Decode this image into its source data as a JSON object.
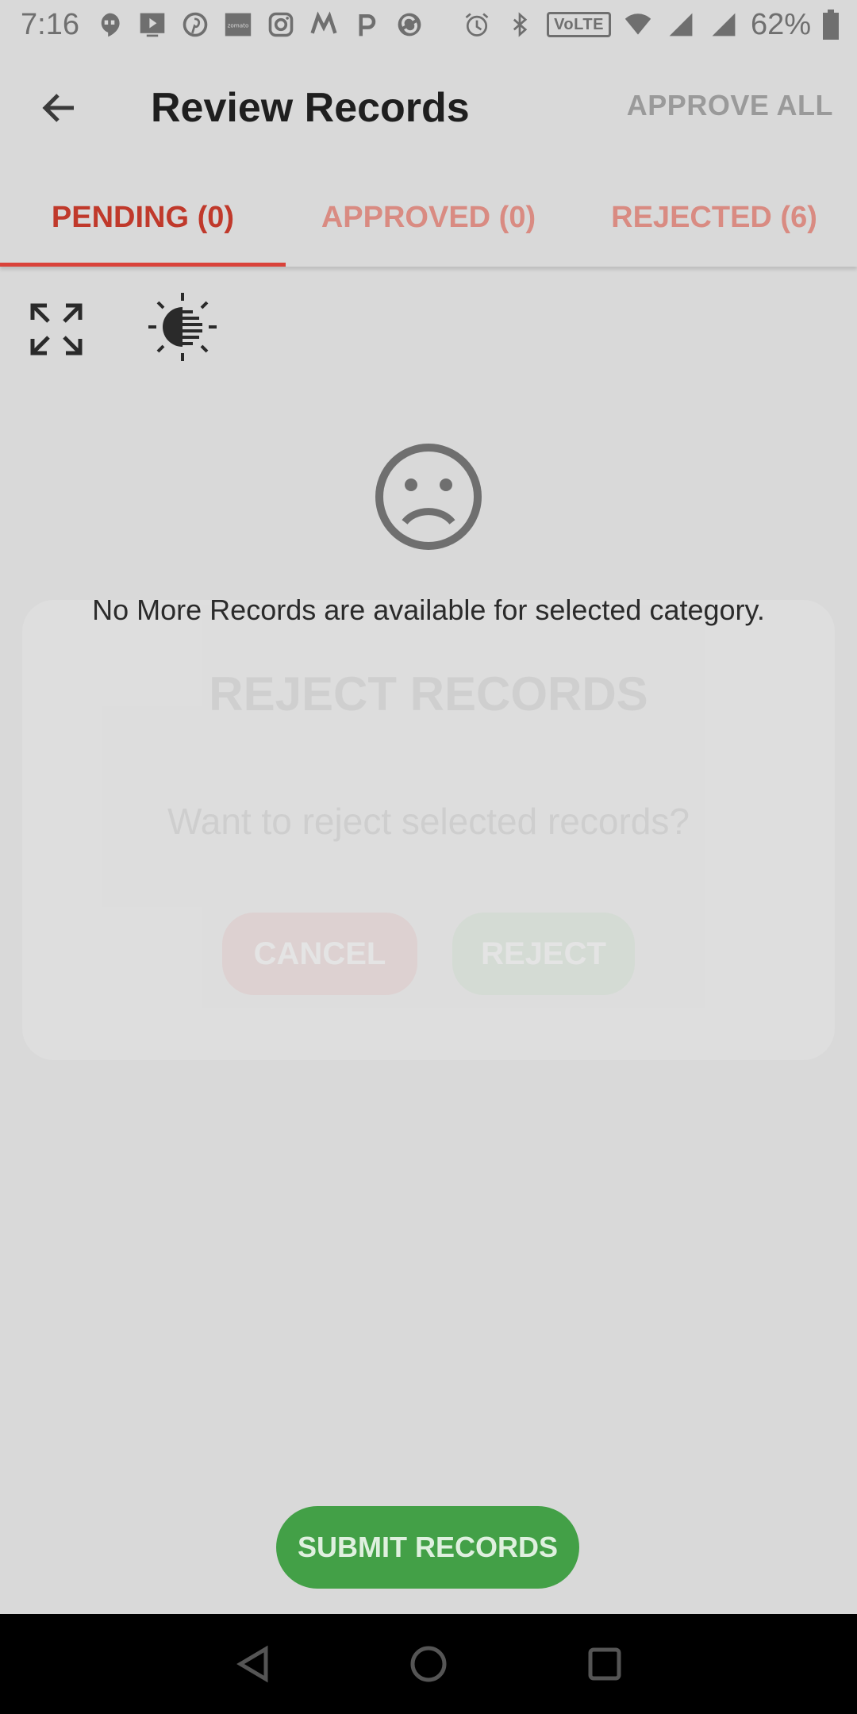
{
  "status_bar": {
    "time": "7:16",
    "network": "VoLTE",
    "battery": "62%",
    "icons": [
      "hangouts-icon",
      "tv-icon",
      "pinterest-icon",
      "zomato-icon",
      "instagram-icon",
      "myntra-icon",
      "p-app-icon",
      "sync-icon",
      "alarm-icon",
      "bluetooth-icon",
      "volte-icon",
      "wifi-icon",
      "signal-icon",
      "signal-icon",
      "battery-icon"
    ]
  },
  "app_bar": {
    "title": "Review Records",
    "action": "APPROVE ALL"
  },
  "tabs": [
    {
      "label": "PENDING (0)"
    },
    {
      "label": "APPROVED (0)"
    },
    {
      "label": "REJECTED (6)"
    }
  ],
  "empty_state": {
    "message": "No More Records are available for selected category."
  },
  "dialog": {
    "title": "REJECT RECORDS",
    "message": "Want to reject selected records?",
    "cancel_label": "CANCEL",
    "reject_label": "REJECT"
  },
  "submit_label": "SUBMIT RECORDS",
  "colors": {
    "accent_red": "#d9423a",
    "submit_green": "#43a047"
  }
}
